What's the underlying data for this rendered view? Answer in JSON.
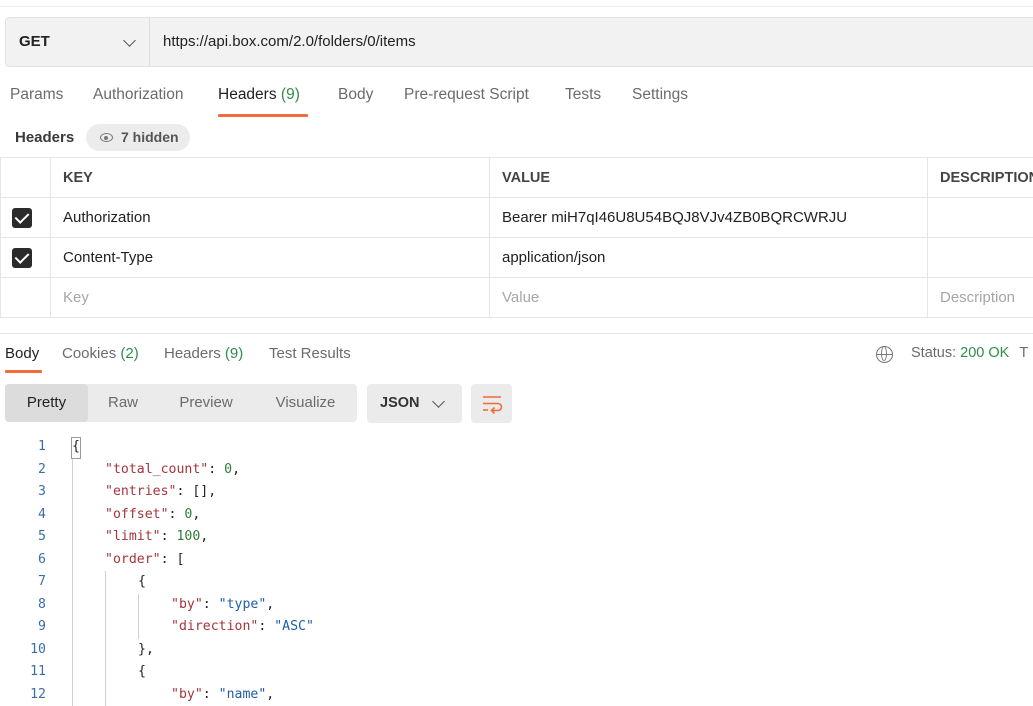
{
  "request": {
    "method": "GET",
    "url": "https://api.box.com/2.0/folders/0/items"
  },
  "request_tabs": [
    {
      "label": "Params"
    },
    {
      "label": "Authorization"
    },
    {
      "label": "Headers",
      "count": "(9)"
    },
    {
      "label": "Body"
    },
    {
      "label": "Pre-request Script"
    },
    {
      "label": "Tests"
    },
    {
      "label": "Settings"
    }
  ],
  "headers_section": {
    "title": "Headers",
    "hidden_label": "7 hidden"
  },
  "headers_table": {
    "columns": [
      "KEY",
      "VALUE",
      "DESCRIPTION"
    ],
    "rows": [
      {
        "checked": true,
        "key": "Authorization",
        "value": "Bearer miH7qI46U8U54BQJ8VJv4ZB0BQRCWRJU",
        "description": ""
      },
      {
        "checked": true,
        "key": "Content-Type",
        "value": "application/json",
        "description": ""
      }
    ],
    "placeholder": {
      "key": "Key",
      "value": "Value",
      "description": "Description"
    }
  },
  "response_tabs": [
    {
      "label": "Body"
    },
    {
      "label": "Cookies",
      "count": "(2)"
    },
    {
      "label": "Headers",
      "count": "(9)"
    },
    {
      "label": "Test Results"
    }
  ],
  "response_status": {
    "label": "Status:",
    "value": "200 OK",
    "trailing": "T"
  },
  "view_modes": [
    "Pretty",
    "Raw",
    "Preview",
    "Visualize"
  ],
  "format": "JSON",
  "icons": {
    "method_dropdown": "chevron-down-icon",
    "hidden": "eye-icon",
    "network": "globe-icon",
    "format_dropdown": "chevron-down-icon",
    "wrap": "wrap-lines-icon"
  },
  "colors": {
    "accent": "#f26b3a",
    "count_green": "#2f8d4d",
    "json_key": "#a4353c",
    "json_string": "#1f5ea8",
    "json_number": "#2f7d3c"
  },
  "code_lines": [
    {
      "n": "1",
      "indent": 0,
      "tokens": [
        [
          "p",
          "{"
        ]
      ]
    },
    {
      "n": "2",
      "indent": 1,
      "tokens": [
        [
          "k",
          "\"total_count\""
        ],
        [
          "p",
          ": "
        ],
        [
          "n",
          "0"
        ],
        [
          "p",
          ","
        ]
      ]
    },
    {
      "n": "3",
      "indent": 1,
      "tokens": [
        [
          "k",
          "\"entries\""
        ],
        [
          "p",
          ": [],"
        ]
      ]
    },
    {
      "n": "4",
      "indent": 1,
      "tokens": [
        [
          "k",
          "\"offset\""
        ],
        [
          "p",
          ": "
        ],
        [
          "n",
          "0"
        ],
        [
          "p",
          ","
        ]
      ]
    },
    {
      "n": "5",
      "indent": 1,
      "tokens": [
        [
          "k",
          "\"limit\""
        ],
        [
          "p",
          ": "
        ],
        [
          "n",
          "100"
        ],
        [
          "p",
          ","
        ]
      ]
    },
    {
      "n": "6",
      "indent": 1,
      "tokens": [
        [
          "k",
          "\"order\""
        ],
        [
          "p",
          ": ["
        ]
      ]
    },
    {
      "n": "7",
      "indent": 2,
      "tokens": [
        [
          "p",
          "{"
        ]
      ]
    },
    {
      "n": "8",
      "indent": 3,
      "tokens": [
        [
          "k",
          "\"by\""
        ],
        [
          "p",
          ": "
        ],
        [
          "s",
          "\"type\""
        ],
        [
          "p",
          ","
        ]
      ]
    },
    {
      "n": "9",
      "indent": 3,
      "tokens": [
        [
          "k",
          "\"direction\""
        ],
        [
          "p",
          ": "
        ],
        [
          "s",
          "\"ASC\""
        ]
      ]
    },
    {
      "n": "10",
      "indent": 2,
      "tokens": [
        [
          "p",
          "},"
        ]
      ]
    },
    {
      "n": "11",
      "indent": 2,
      "tokens": [
        [
          "p",
          "{"
        ]
      ]
    },
    {
      "n": "12",
      "indent": 3,
      "tokens": [
        [
          "k",
          "\"by\""
        ],
        [
          "p",
          ": "
        ],
        [
          "s",
          "\"name\""
        ],
        [
          "p",
          ","
        ]
      ]
    }
  ]
}
